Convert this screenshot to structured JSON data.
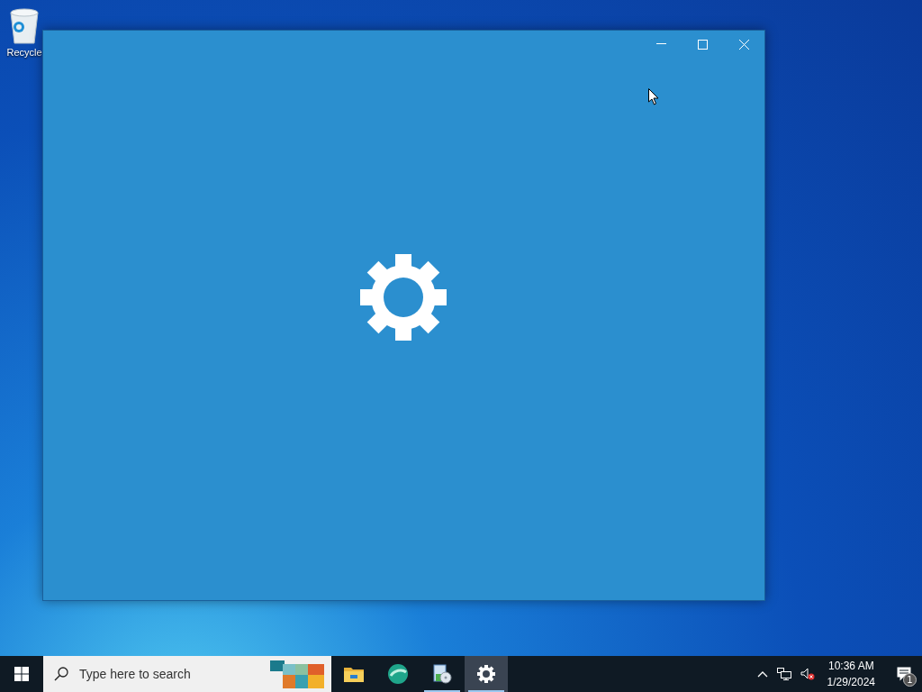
{
  "desktop_icons": [
    {
      "label": "Recycle",
      "kind": "recycle"
    }
  ],
  "window": {
    "kind": "settings-splash"
  },
  "taskbar": {
    "search": {
      "placeholder": "Type here to search"
    },
    "apps": [
      {
        "kind": "folder",
        "running": false,
        "selected": false
      },
      {
        "kind": "globe",
        "running": false,
        "selected": false
      },
      {
        "kind": "installer",
        "running": true,
        "selected": false
      },
      {
        "kind": "gear",
        "running": true,
        "selected": true
      }
    ],
    "clock": {
      "time": "10:36 AM",
      "date": "1/29/2024"
    },
    "notifications": {
      "count": "1"
    }
  }
}
